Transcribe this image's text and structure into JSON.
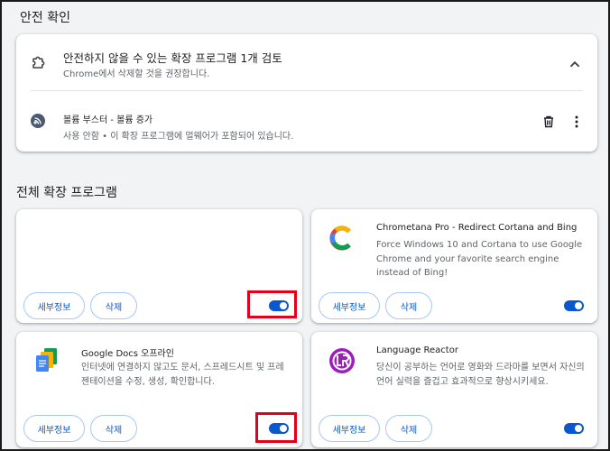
{
  "safety_check": {
    "heading": "안전 확인",
    "title": "안전하지 않을 수 있는 확장 프로그램 1개 검토",
    "subtitle": "Chrome에서 삭제할 것을 권장합니다.",
    "item": {
      "name": "볼륨 부스터 - 볼륨 증가",
      "status": "사용 안함 • 이 확장 프로그램에 멀웨어가 포함되어 있습니다."
    }
  },
  "all_extensions": {
    "heading": "전체 확장 프로그램",
    "details_label": "세부정보",
    "remove_label": "삭제",
    "cards": [
      {
        "name": "",
        "description": "",
        "icon": "blank",
        "enabled": true
      },
      {
        "name": "Chrometana Pro - Redirect Cortana and Bing",
        "description": "Force Windows 10 and Cortana to use Google Chrome and your favorite search engine instead of Bing!",
        "icon": "chrometana-icon",
        "enabled": true
      },
      {
        "name": "Google Docs 오프라인",
        "description": "인터넷에 연결하지 않고도 문서, 스프레드시트 및 프레젠테이션을 수정, 생성, 확인합니다.",
        "icon": "google-docs-icon",
        "enabled": true
      },
      {
        "name": "Language Reactor",
        "description": "당신이 공부하는 언어로 영화와 드라마를 보면서 자신의 언어 실력을 즐겁고 효과적으로 향상시키세요.",
        "icon": "language-reactor-icon",
        "enabled": true
      }
    ]
  },
  "colors": {
    "accent": "#0b57d0",
    "highlight": "#e3001b"
  }
}
